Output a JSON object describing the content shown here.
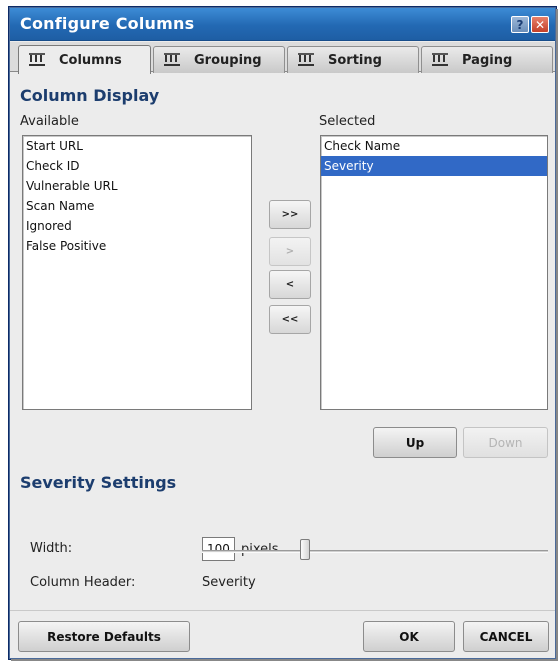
{
  "window": {
    "title": "Configure Columns",
    "help_label": "?",
    "close_label": "✕"
  },
  "tabs": [
    {
      "label": "Columns",
      "active": true
    },
    {
      "label": "Grouping",
      "active": false
    },
    {
      "label": "Sorting",
      "active": false
    },
    {
      "label": "Paging",
      "active": false
    }
  ],
  "column_display": {
    "heading": "Column Display",
    "available_label": "Available",
    "selected_label": "Selected",
    "available_items": [
      "Start URL",
      "Check ID",
      "Vulnerable URL",
      "Scan Name",
      "Ignored",
      "False Positive"
    ],
    "selected_items": [
      "Check Name",
      "Severity"
    ],
    "selected_index": 1,
    "move_all_right_label": ">>",
    "move_right_label": ">",
    "move_left_label": "<",
    "move_all_left_label": "<<",
    "up_label": "Up",
    "down_label": "Down"
  },
  "severity_settings": {
    "heading": "Severity Settings",
    "width_label": "Width:",
    "width_value": "100",
    "width_unit": "pixels",
    "column_header_label": "Column Header:",
    "column_header_value": "Severity"
  },
  "footer": {
    "restore_label": "Restore Defaults",
    "ok_label": "OK",
    "cancel_label": "CANCEL"
  },
  "colors": {
    "titlebar": "#2369b3",
    "selection": "#3169c6",
    "heading": "#1c3d6e"
  }
}
